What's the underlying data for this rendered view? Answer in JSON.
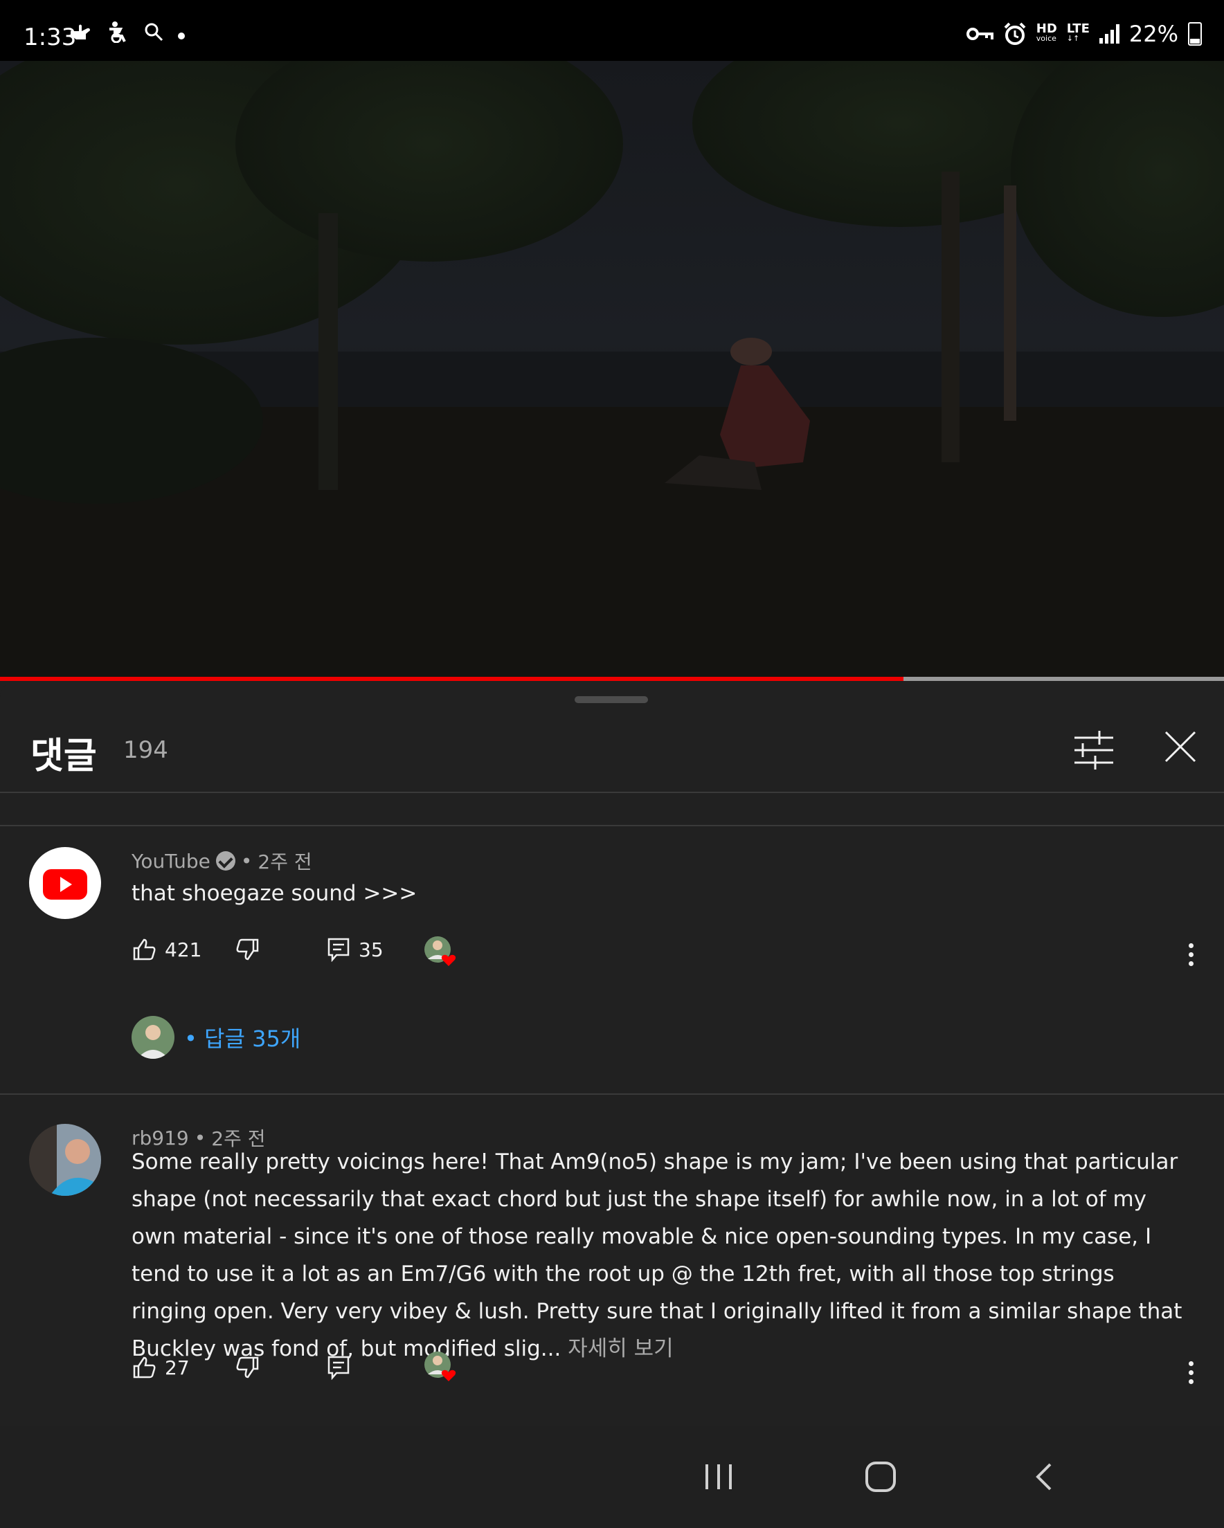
{
  "status_bar": {
    "time": "1:33",
    "left_icons": [
      "hand-gesture-icon",
      "accessibility-icon",
      "search-icon",
      "dot-icon"
    ],
    "right_icons": [
      "vpn-key-icon",
      "alarm-icon",
      "hd-voice-icon",
      "lte-icon",
      "signal-icon",
      "battery-icon"
    ],
    "hd_label": "HD",
    "voice_label": "voice",
    "lte_label": "LTE",
    "battery": "22%"
  },
  "video": {
    "progress": 0.738
  },
  "comments_panel": {
    "title": "댓글",
    "count": "194",
    "filter_icon": "tune-icon",
    "close_icon": "close-icon"
  },
  "comments": [
    {
      "author": "YouTube",
      "verified": true,
      "separator": "•",
      "time": "2주 전",
      "text": "that shoegaze sound >>>",
      "likes": "421",
      "replies_count": "35",
      "replies_label": "• 답글 35개"
    },
    {
      "author": "rb919",
      "separator": "•",
      "time": "2주 전",
      "text": "Some really pretty voicings here! That Am9(no5) shape is my jam; I've been using that particular shape (not necessarily that exact chord but just the shape itself) for awhile now, in a lot of my own material - since it's one of those really movable & nice open-sounding types. In my case, I tend to use it a lot as an Em7/G6 with the root up @ the 12th fret, with all those top strings ringing open. Very very vibey & lush. Pretty sure that I originally lifted it from a similar shape that Buckley was fond of, but modified slig...",
      "more": "자세히 보기",
      "likes": "27"
    }
  ],
  "colors": {
    "accent_red": "#ff0000",
    "link_blue": "#3ea6ff",
    "panel_bg": "#212121"
  },
  "nav_icons": [
    "recent-apps-icon",
    "home-icon",
    "back-icon"
  ]
}
